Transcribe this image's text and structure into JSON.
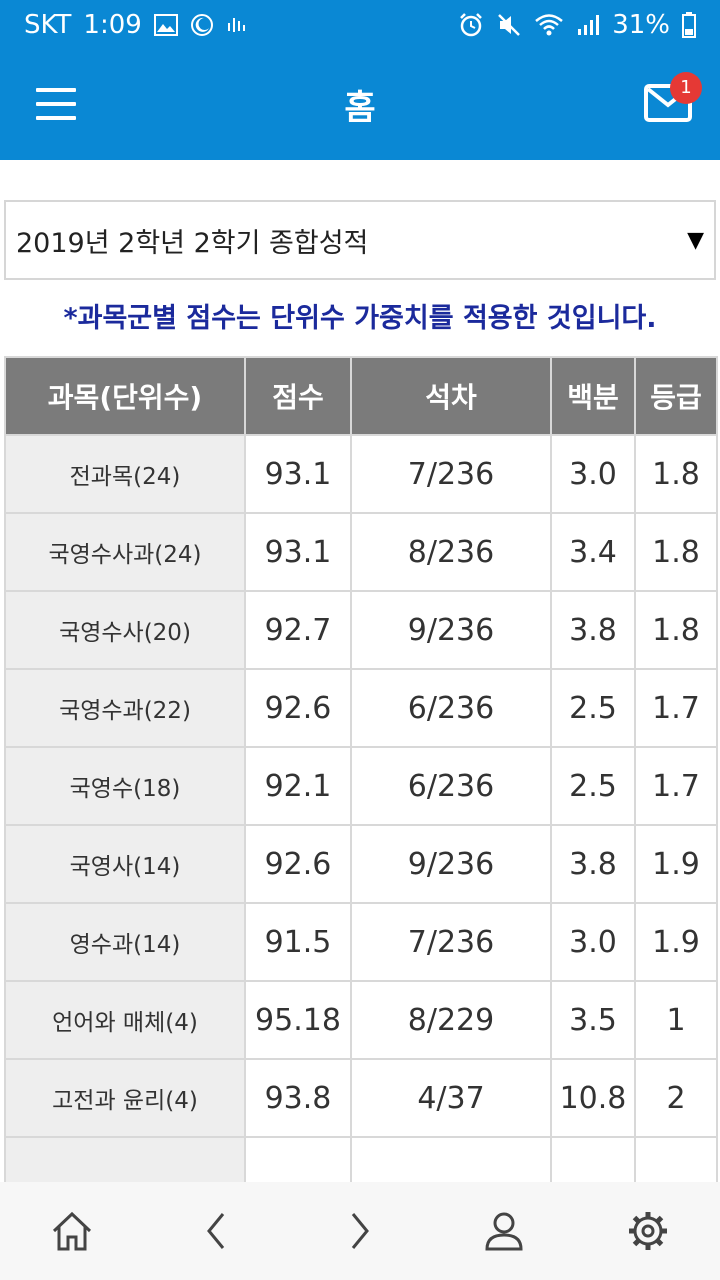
{
  "status_bar": {
    "carrier": "SKT",
    "time": "1:09",
    "battery": "31%",
    "left_icons": [
      "image-icon",
      "moon-icon",
      "signal-activity-icon"
    ],
    "right_icons": [
      "alarm-icon",
      "mute-icon",
      "wifi-icon",
      "cell-signal-icon",
      "battery-icon"
    ]
  },
  "header": {
    "title": "홈",
    "menu_icon": "hamburger-menu-icon",
    "mail_icon": "mail-icon",
    "mail_badge": "1"
  },
  "term_selector": {
    "value": "2019년 2학년 2학기 종합성적",
    "arrow": "▼"
  },
  "notice": "*과목군별 점수는 단위수 가중치를 적용한 것입니다.",
  "table": {
    "columns": [
      "과목(단위수)",
      "점수",
      "석차",
      "백분",
      "등급"
    ],
    "rows": [
      {
        "subject": "전과목(24)",
        "score": "93.1",
        "rank": "7/236",
        "percentile": "3.0",
        "grade": "1.8"
      },
      {
        "subject": "국영수사과(24)",
        "score": "93.1",
        "rank": "8/236",
        "percentile": "3.4",
        "grade": "1.8"
      },
      {
        "subject": "국영수사(20)",
        "score": "92.7",
        "rank": "9/236",
        "percentile": "3.8",
        "grade": "1.8"
      },
      {
        "subject": "국영수과(22)",
        "score": "92.6",
        "rank": "6/236",
        "percentile": "2.5",
        "grade": "1.7"
      },
      {
        "subject": "국영수(18)",
        "score": "92.1",
        "rank": "6/236",
        "percentile": "2.5",
        "grade": "1.7"
      },
      {
        "subject": "국영사(14)",
        "score": "92.6",
        "rank": "9/236",
        "percentile": "3.8",
        "grade": "1.9"
      },
      {
        "subject": "영수과(14)",
        "score": "91.5",
        "rank": "7/236",
        "percentile": "3.0",
        "grade": "1.9"
      },
      {
        "subject": "언어와 매체(4)",
        "score": "95.18",
        "rank": "8/229",
        "percentile": "3.5",
        "grade": "1"
      },
      {
        "subject": "고전과 윤리(4)",
        "score": "93.8",
        "rank": "4/37",
        "percentile": "10.8",
        "grade": "2"
      }
    ]
  },
  "bottom_nav": {
    "icons": [
      "home-icon",
      "back-chevron-icon",
      "forward-chevron-icon",
      "profile-icon",
      "settings-gear-icon"
    ]
  },
  "colors": {
    "header_bg": "#0a88d4",
    "table_header_bg": "#7b7b7b",
    "subject_cell_bg": "#eeeeee",
    "notice_text": "#1b2a9c",
    "badge": "#e53935"
  }
}
